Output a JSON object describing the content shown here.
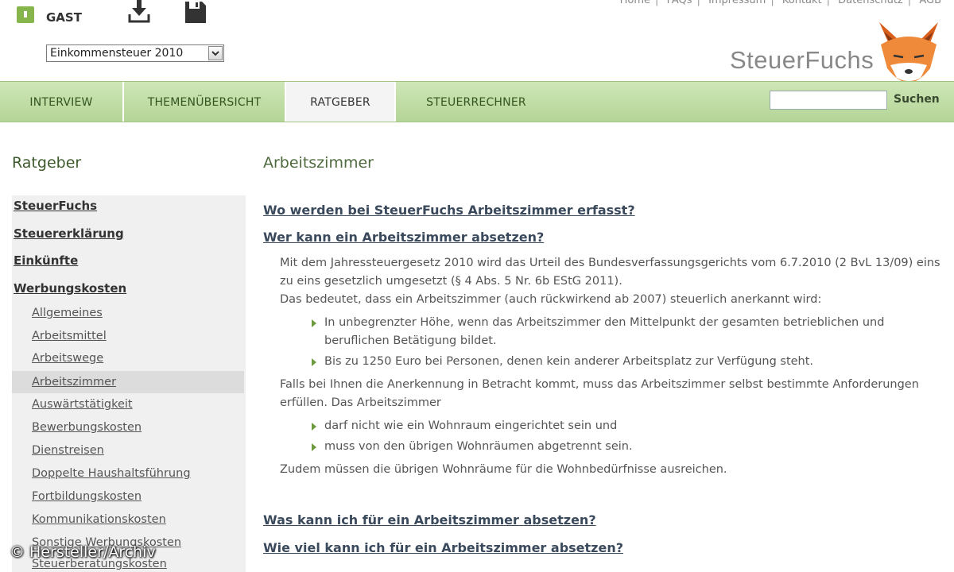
{
  "header": {
    "user_label": "GAST",
    "year_select": "Einkommensteuer 2010",
    "top_links": [
      "Home",
      "FAQs",
      "Impressum",
      "Kontakt",
      "Datenschutz",
      "AGB"
    ],
    "logo_text": "SteuerFuchs"
  },
  "nav": {
    "tabs": [
      "INTERVIEW",
      "THEMENÜBERSICHT",
      "RATGEBER",
      "STEUERRECHNER"
    ],
    "active_tab": "RATGEBER",
    "search_placeholder": "",
    "search_button": "Suchen"
  },
  "sidebar": {
    "title": "Ratgeber",
    "top_items": [
      "SteuerFuchs",
      "Steuererklärung",
      "Einkünfte",
      "Werbungskosten"
    ],
    "sub_items": [
      "Allgemeines",
      "Arbeitsmittel",
      "Arbeitswege",
      "Arbeitszimmer",
      "Auswärtstätigkeit",
      "Bewerbungskosten",
      "Dienstreisen",
      "Doppelte Haushaltsführung",
      "Fortbildungskosten",
      "Kommunikationskosten",
      "Sonstige Werbungskosten",
      "Steuerberatungskosten"
    ],
    "selected_sub_item": "Arbeitszimmer"
  },
  "main": {
    "title": "Arbeitszimmer",
    "faq": [
      "Wo werden bei SteuerFuchs Arbeitszimmer erfasst?",
      "Wer kann ein Arbeitszimmer absetzen?",
      "Was kann ich für ein Arbeitszimmer absetzen?",
      "Wie viel kann ich für ein Arbeitszimmer absetzen?"
    ],
    "answer": {
      "p1": "Mit dem Jahressteuergesetz 2010 wird das Urteil des Bundesverfassungsgerichts vom 6.7.2010 (2 BvL 13/09) eins zu eins gesetzlich umgesetzt (§ 4 Abs. 5 Nr. 6b EStG 2011).",
      "p2": "Das bedeutet, dass ein Arbeitszimmer (auch rückwirkend ab 2007) steuerlich anerkannt wird:",
      "bullets1": [
        "In unbegrenzter Höhe, wenn das Arbeitszimmer den Mittelpunkt der gesamten betrieblichen und beruflichen Betätigung bildet.",
        "Bis zu 1250 Euro bei Personen, denen kein anderer Arbeitsplatz zur Verfügung steht."
      ],
      "p3": "Falls bei Ihnen die Anerkennung in Betracht kommt, muss das Arbeitszimmer selbst bestimmte Anforderungen erfüllen. Das Arbeitszimmer",
      "bullets2": [
        "darf nicht wie ein Wohnraum eingerichtet sein und",
        "muss von den übrigen Wohnräumen abgetrennt sein."
      ],
      "p4": "Zudem müssen die übrigen Wohnräume für die Wohnbedürfnisse ausreichen."
    }
  },
  "overlay": {
    "copyright": "© Hersteller/Archiv"
  },
  "colors": {
    "nav_green": "#b3d596",
    "title_green": "#4e6a3e",
    "link_blue": "#3a4a5c",
    "fox_orange": "#e8782a"
  },
  "icons": [
    "lock-icon",
    "download-icon",
    "save-icon",
    "chevron-down-icon",
    "fox-logo",
    "bullet-icon"
  ]
}
